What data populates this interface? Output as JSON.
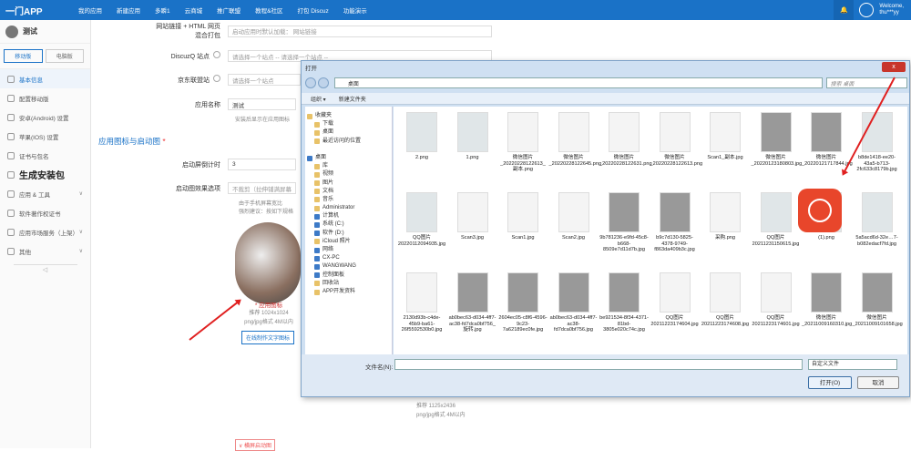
{
  "topbar": {
    "logo": "一门APP",
    "nav": [
      "我的应用",
      "新建应用",
      "多瞬1",
      "云商城",
      "推广联盟",
      "教程&社区",
      "打包 Discuz",
      "功能演示"
    ],
    "welcome_line1": "Welcome,",
    "welcome_line2": "thu***yy"
  },
  "sidebar": {
    "app_name": "测试",
    "tab_mobile": "移动版",
    "tab_pc": "电脑版",
    "items": [
      {
        "label": "基本信息",
        "icon": "info-icon"
      },
      {
        "label": "配置移动版",
        "icon": "config-icon"
      },
      {
        "label": "安卓(Android) 设置",
        "icon": "android-icon"
      },
      {
        "label": "苹果(IOS) 设置",
        "icon": "apple-icon"
      },
      {
        "label": "证书与包名",
        "icon": "certificate-icon"
      },
      {
        "label": "生成安装包",
        "icon": "build-icon"
      },
      {
        "label": "应用 & 工具",
        "icon": "tools-icon"
      },
      {
        "label": "软件著作权证书",
        "icon": "copyright-icon"
      },
      {
        "label": "应用市场服务（上架）",
        "icon": "market-icon"
      },
      {
        "label": "其他",
        "icon": "more-icon"
      }
    ]
  },
  "form": {
    "row1_label_a": "网站链接 + HTML 网页",
    "row1_label_b": "混合打包",
    "row1_select": "启动应用时默认加载：  网站链接",
    "row2_label": "DiscuzQ 站点",
    "row2_select": "请选择一个站点    -- 请选择一个站点 --",
    "row3_label": "京东联盟站",
    "row3_select": "请选择一个站点",
    "app_name_label": "应用名称",
    "app_name_value": "测试",
    "app_name_hint": "安装后显示在应用图标",
    "section_title": "应用图标与启动图",
    "countdown_label": "启动屏倒计时",
    "countdown_value": "3",
    "effect_label": "启动图效果选项",
    "effect_value": "不裁剪（拉伸铺满屏幕",
    "effect_hint1": "由于手机屏幕宽比",
    "effect_hint2": "强烈建议：按如下规格",
    "icon_caption": "* 应用图标",
    "icon_size": "推荐 1024x1024",
    "icon_format": "png/jpg格式 4M以内",
    "icon_button": "在线制作文字图标",
    "splash_size": "推荐 1125x2436",
    "splash_format": "png/jpg格式 4M以内",
    "splash_button": "∨ 横屏启动图"
  },
  "dialog": {
    "title": "打开",
    "close": "x",
    "path": "桌面",
    "search_placeholder": "搜索 桌面",
    "toolbar": [
      "组织 ▾",
      "新建文件夹"
    ],
    "tree": [
      {
        "label": "收藏夹",
        "type": "star"
      },
      {
        "label": "下载",
        "type": "folder"
      },
      {
        "label": "桌面",
        "type": "folder"
      },
      {
        "label": "最近访问的位置",
        "type": "folder"
      },
      {
        "label": "",
        "type": "blank"
      },
      {
        "label": "桌面",
        "type": "blue"
      },
      {
        "label": "库",
        "type": "folder"
      },
      {
        "label": "视频",
        "type": "folder"
      },
      {
        "label": "图片",
        "type": "folder"
      },
      {
        "label": "文档",
        "type": "folder"
      },
      {
        "label": "音乐",
        "type": "folder"
      },
      {
        "label": "Administrator",
        "type": "folder"
      },
      {
        "label": "计算机",
        "type": "blue"
      },
      {
        "label": "系统 (C:)",
        "type": "blue"
      },
      {
        "label": "软件 (D:)",
        "type": "blue"
      },
      {
        "label": "iCloud 照片",
        "type": "folder"
      },
      {
        "label": "网络",
        "type": "blue"
      },
      {
        "label": "CX-PC",
        "type": "blue"
      },
      {
        "label": "WANGWANG",
        "type": "blue"
      },
      {
        "label": "控制面板",
        "type": "blue"
      },
      {
        "label": "回收站",
        "type": "folder"
      },
      {
        "label": "APP开发资料",
        "type": "folder"
      }
    ],
    "files": [
      {
        "name": "2.png",
        "kind": "img"
      },
      {
        "name": "1.png",
        "kind": "img"
      },
      {
        "name": "微信图片_20220228122613_副本.png",
        "kind": "doc"
      },
      {
        "name": "微信图片_20220228122645.png",
        "kind": "doc"
      },
      {
        "name": "微信图片_20220228122631.png",
        "kind": "doc"
      },
      {
        "name": "微信图片_20220228122613.png",
        "kind": "doc"
      },
      {
        "name": "Scan1_副本.jpg",
        "kind": "doc"
      },
      {
        "name": "微信图片_20220123180803.jpg",
        "kind": "photo"
      },
      {
        "name": "微信图片_20220121717844.jpg",
        "kind": "photo"
      },
      {
        "name": "b8de1418-ee20-43a5-b713-2fc633c8179b.jpg",
        "kind": "img"
      },
      {
        "name": "QQ图片20220112094935.jpg",
        "kind": "img"
      },
      {
        "name": "Scan3.jpg",
        "kind": "doc"
      },
      {
        "name": "Scan1.jpg",
        "kind": "doc"
      },
      {
        "name": "Scan2.jpg",
        "kind": "doc"
      },
      {
        "name": "9b781236-e9fd-45c8-b668-8509e7d11d7b.jpg",
        "kind": "photo"
      },
      {
        "name": "b9c7d130-5825-4378-9749-f863da409b3c.jpg",
        "kind": "photo"
      },
      {
        "name": "采购.png",
        "kind": "doc"
      },
      {
        "name": "QQ图片20211231150615.jpg",
        "kind": "img"
      },
      {
        "name": "(1).png",
        "kind": "img"
      },
      {
        "name": "5a5acd6d-32e…7-b082edacf7fd.jpg",
        "kind": "img"
      },
      {
        "name": "2130d93b-c4de-45b9-ba61-26f5592530b0.jpg",
        "kind": "doc"
      },
      {
        "name": "ab0bec63-d034-4ff7-ac38-fd7dca0bf756_旋转.jpg",
        "kind": "photo"
      },
      {
        "name": "2604ec05-c8f6-4596-9c23-7a62189ec0fe.jpg",
        "kind": "photo"
      },
      {
        "name": "ab0bec63-d034-4ff7-ac38-fd7dca0bf756.jpg",
        "kind": "photo"
      },
      {
        "name": "be921534-8f34-4371-81bd-3805e020c74c.jpg",
        "kind": "photo"
      },
      {
        "name": "QQ图片20211223174604.jpg",
        "kind": "doc"
      },
      {
        "name": "QQ图片20211223174608.jpg",
        "kind": "doc"
      },
      {
        "name": "QQ图片20211223174601.jpg",
        "kind": "doc"
      },
      {
        "name": "微信图片_20211009160310.jpg",
        "kind": "photo"
      },
      {
        "name": "微信图片_20211009101658.jpg",
        "kind": "photo"
      }
    ],
    "filename_label": "文件名(N):",
    "filename_value": "",
    "filetype": "自定义文件",
    "open_button": "打开(O)",
    "cancel_button": "取消"
  },
  "colors": {
    "accent": "#1a72c7",
    "arrow": "#e02020",
    "app_logo": "#e8462b"
  }
}
